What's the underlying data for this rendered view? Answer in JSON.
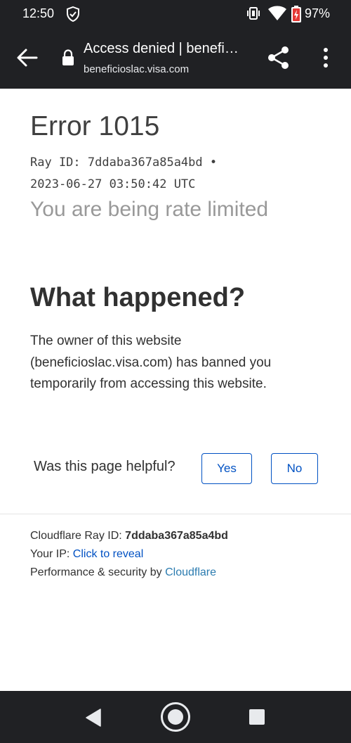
{
  "status_bar": {
    "time": "12:50",
    "battery_percent": "97%",
    "icons": [
      "shield-check-icon",
      "vibrate-icon",
      "wifi-icon",
      "battery-icon"
    ]
  },
  "toolbar": {
    "title": "Access denied | benefi…",
    "url": "beneficioslac.visa.com",
    "icons": [
      "back-arrow-icon",
      "lock-icon",
      "share-icon",
      "more-vert-icon"
    ]
  },
  "page": {
    "error_title": "Error 1015",
    "ray_line_1": "Ray ID: 7ddaba367a85a4bd •",
    "ray_line_2": "2023-06-27 03:50:42 UTC",
    "subtitle": "You are being rate limited",
    "what_happened_heading": "What happened?",
    "explanation": "The owner of this website (beneficioslac.visa.com) has banned you temporarily from accessing this website."
  },
  "feedback": {
    "question": "Was this page helpful?",
    "yes_label": "Yes",
    "no_label": "No"
  },
  "footer": {
    "ray_label": "Cloudflare Ray ID: ",
    "ray_id": "7ddaba367a85a4bd",
    "ip_label": "Your IP: ",
    "ip_link": "Click to reveal",
    "perf_label": "Performance & security by ",
    "perf_link": "Cloudflare"
  },
  "colors": {
    "system_bar": "#202124",
    "link_blue": "#0051c3",
    "heading_text": "#313131",
    "muted_text": "#999999"
  },
  "nav_bar": {
    "icons": [
      "nav-back-icon",
      "nav-home-icon",
      "nav-recents-icon"
    ]
  }
}
